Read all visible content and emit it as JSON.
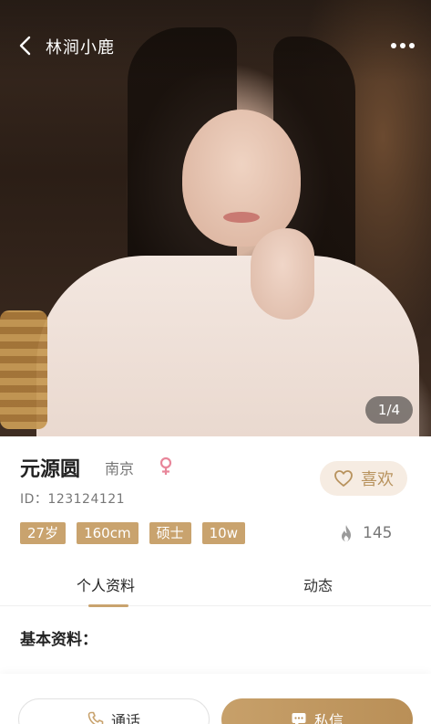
{
  "header": {
    "title": "林涧小鹿",
    "back_icon": "back-arrow-icon",
    "more_icon": "more-dots-icon",
    "photo_counter": "1/4"
  },
  "profile": {
    "name": "元源圆",
    "city": "南京",
    "gender_icon": "female-icon",
    "id_label": "ID：123124121",
    "like_label": "喜欢",
    "tags": [
      "27岁",
      "160cm",
      "硕士",
      "10w"
    ],
    "hot_count": "145"
  },
  "tabs": [
    {
      "label": "个人资料",
      "active": true
    },
    {
      "label": "动态",
      "active": false
    }
  ],
  "section": {
    "title": "基本资料："
  },
  "actions": {
    "call_label": "通话",
    "message_label": "私信"
  },
  "colors": {
    "accent": "#c9a36e",
    "like_bg": "#f6ece2",
    "gender": "#e8869a"
  }
}
